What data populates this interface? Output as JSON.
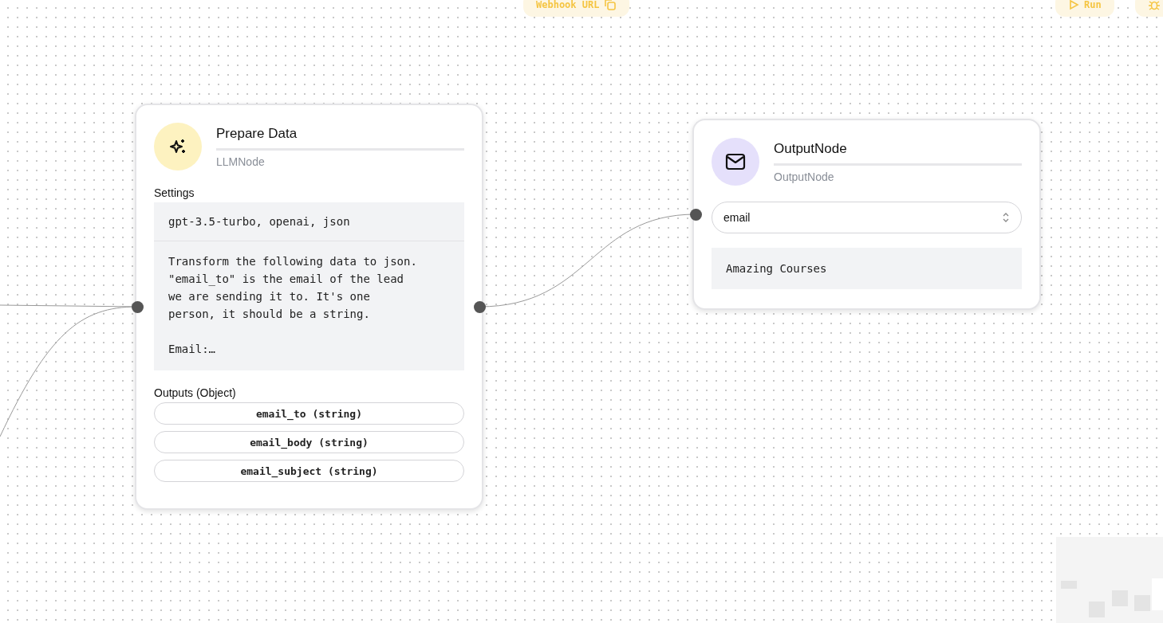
{
  "toolbar": [
    {
      "kind": "webhook",
      "label": "Webhook URL"
    },
    {
      "kind": "run",
      "label": "Run"
    },
    {
      "kind": "debug"
    }
  ],
  "llm_node": {
    "title": "Prepare Data",
    "type": "LLMNode",
    "settings_label": "Settings",
    "settings": "gpt-3.5-turbo, openai, json",
    "prompt": "Transform the following data to json.\n\"email_to\" is the email of the lead\nwe are sending it to. It's one\nperson, it should be a string.\n\nEmail:…",
    "outputs_label": "Outputs (Object)",
    "outputs": [
      "email_to (string)",
      "email_body (string)",
      "email_subject (string)"
    ]
  },
  "output_node": {
    "title": "OutputNode",
    "type": "OutputNode",
    "select_value": "email",
    "text": "Amazing Courses"
  }
}
